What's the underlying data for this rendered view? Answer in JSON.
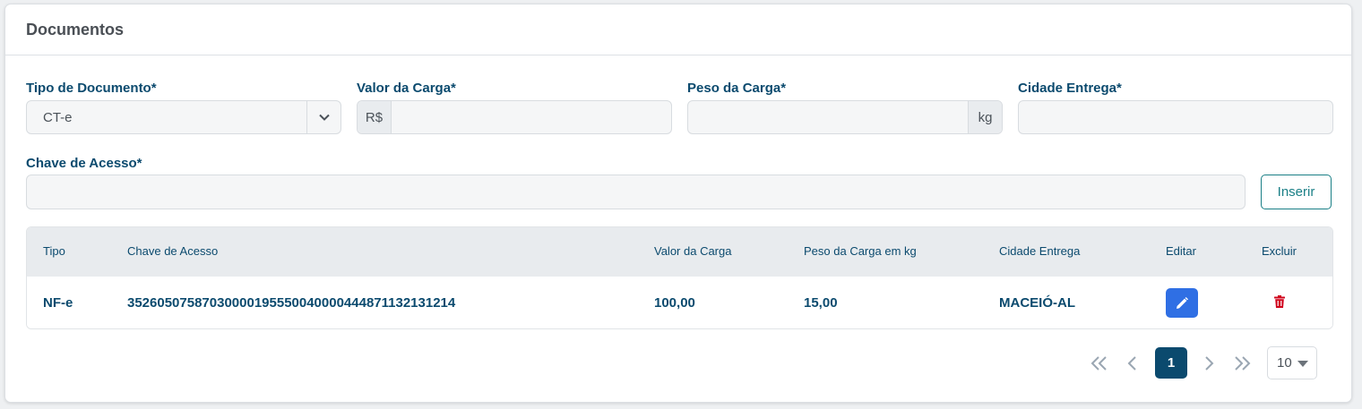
{
  "card": {
    "title": "Documentos"
  },
  "form": {
    "tipo_documento": {
      "label": "Tipo de Documento*",
      "value": "CT-e"
    },
    "valor_carga": {
      "label": "Valor da Carga*",
      "prefix": "R$",
      "value": ""
    },
    "peso_carga": {
      "label": "Peso da Carga*",
      "suffix": "kg",
      "value": ""
    },
    "cidade_entrega": {
      "label": "Cidade Entrega*",
      "value": ""
    },
    "chave_acesso": {
      "label": "Chave de Acesso*",
      "value": ""
    },
    "insert_label": "Inserir"
  },
  "table": {
    "headers": [
      "Tipo",
      "Chave de Acesso",
      "Valor da Carga",
      "Peso da Carga em kg",
      "Cidade Entrega",
      "Editar",
      "Excluir"
    ],
    "rows": [
      {
        "tipo": "NF-e",
        "chave": "35260507587030000195550040000444871132131214",
        "valor": "100,00",
        "peso": "15,00",
        "cidade": "MACEIÓ-AL"
      }
    ]
  },
  "pagination": {
    "current_page": "1",
    "page_size": "10"
  },
  "colors": {
    "primary": "#0b4a6e",
    "accent": "#1a7f86",
    "edit": "#2f6fe4",
    "delete": "#d0021b"
  }
}
